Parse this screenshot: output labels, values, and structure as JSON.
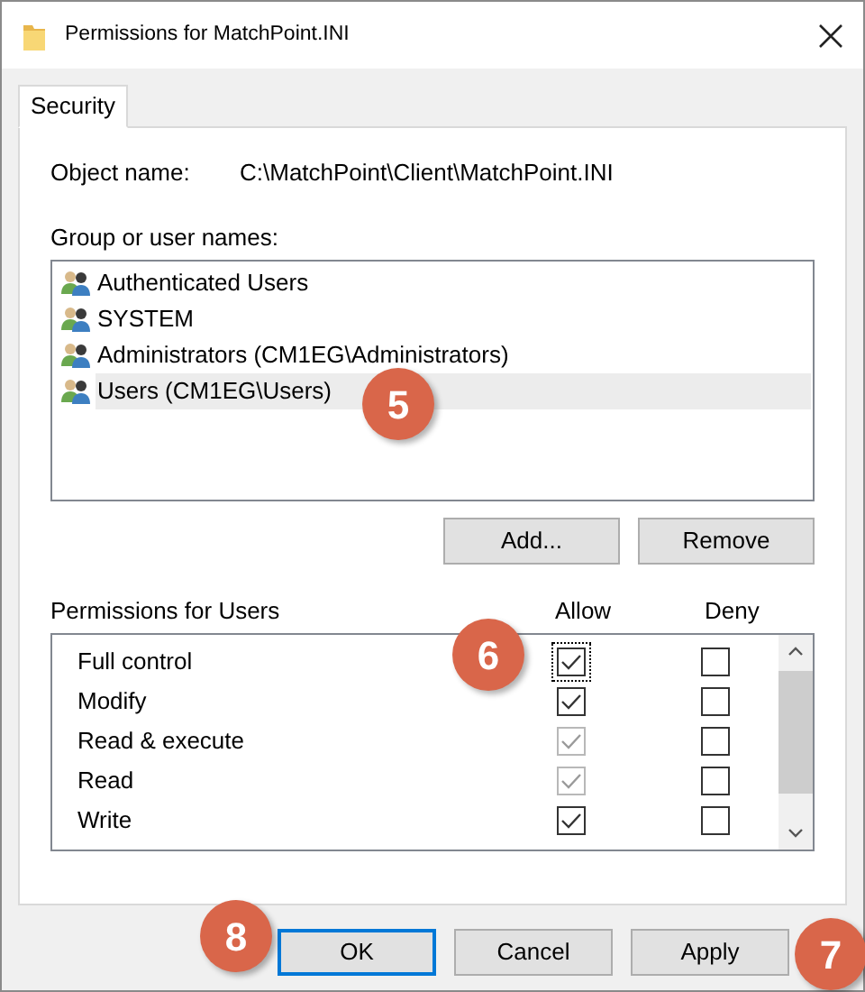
{
  "window": {
    "title": "Permissions for MatchPoint.INI"
  },
  "tabs": [
    {
      "label": "Security",
      "selected": true
    }
  ],
  "object_name": {
    "label": "Object name:",
    "value": "C:\\MatchPoint\\Client\\MatchPoint.INI"
  },
  "groups": {
    "label": "Group or user names:",
    "items": [
      {
        "name": "Authenticated Users",
        "selected": false
      },
      {
        "name": "SYSTEM",
        "selected": false
      },
      {
        "name": "Administrators (CM1EG\\Administrators)",
        "selected": false
      },
      {
        "name": "Users (CM1EG\\Users)",
        "selected": true
      }
    ]
  },
  "group_buttons": [
    "Add...",
    "Remove"
  ],
  "permissions": {
    "label": "Permissions for Users",
    "columns": [
      "Allow",
      "Deny"
    ],
    "rows": [
      {
        "name": "Full control",
        "allow": {
          "checked": true,
          "disabled": false,
          "focused": true
        },
        "deny": {
          "checked": false,
          "disabled": false
        }
      },
      {
        "name": "Modify",
        "allow": {
          "checked": true,
          "disabled": false
        },
        "deny": {
          "checked": false,
          "disabled": false
        }
      },
      {
        "name": "Read & execute",
        "allow": {
          "checked": true,
          "disabled": true
        },
        "deny": {
          "checked": false,
          "disabled": false
        }
      },
      {
        "name": "Read",
        "allow": {
          "checked": true,
          "disabled": true
        },
        "deny": {
          "checked": false,
          "disabled": false
        }
      },
      {
        "name": "Write",
        "allow": {
          "checked": true,
          "disabled": false
        },
        "deny": {
          "checked": false,
          "disabled": false
        }
      }
    ]
  },
  "dialog_buttons": [
    {
      "label": "OK",
      "selected": true
    },
    {
      "label": "Cancel",
      "selected": false
    },
    {
      "label": "Apply",
      "selected": false
    }
  ],
  "callouts": [
    {
      "label": "5"
    },
    {
      "label": "6"
    },
    {
      "label": "7"
    },
    {
      "label": "8"
    }
  ]
}
